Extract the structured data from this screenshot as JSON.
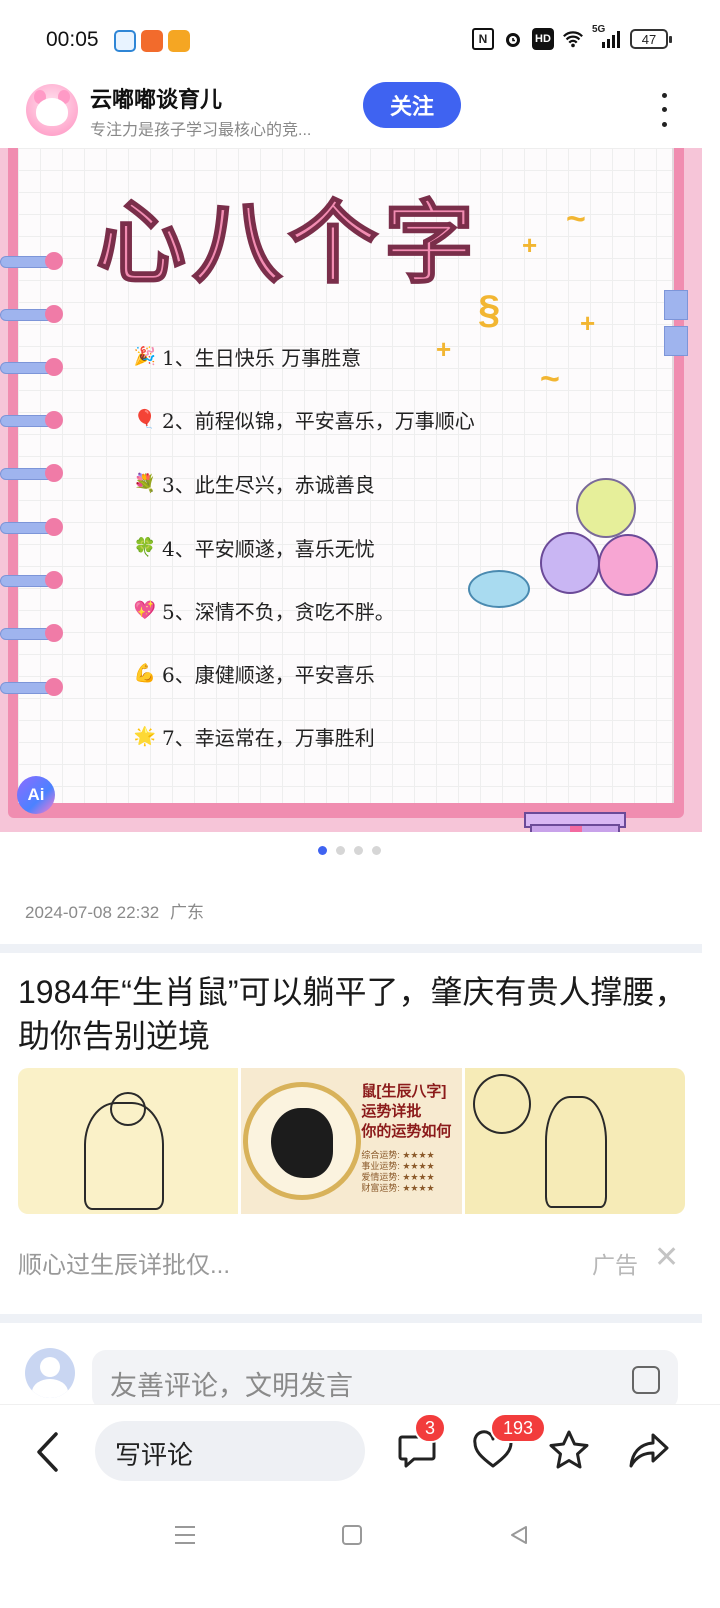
{
  "status_bar": {
    "time": "00:05",
    "battery": "47",
    "network": "5G",
    "hd": "HD",
    "nfc": "N"
  },
  "header": {
    "author_name": "云嘟嘟谈育儿",
    "author_desc": "专注力是孩子学习最核心的竞...",
    "follow_label": "关注"
  },
  "hero": {
    "title": "心八个字",
    "wishes": [
      {
        "icon": "party-popper-icon",
        "glyph": "🎉",
        "text": "1、生日快乐 万事胜意"
      },
      {
        "icon": "balloon-icon",
        "glyph": "🎈",
        "text": "2、前程似锦，平安喜乐，万事顺心"
      },
      {
        "icon": "bouquet-icon",
        "glyph": "💐",
        "text": "3、此生尽兴，赤诚善良"
      },
      {
        "icon": "clover-icon",
        "glyph": "🍀",
        "text": "4、平安顺遂，喜乐无忧"
      },
      {
        "icon": "heart-icon",
        "glyph": "💖",
        "text": "5、深情不负，贪吃不胖。"
      },
      {
        "icon": "flexed-arm-icon",
        "glyph": "💪",
        "text": "6、康健顺遂，平安喜乐"
      },
      {
        "icon": "star-icon",
        "glyph": "🌟",
        "text": "7、幸运常在，万事胜利"
      }
    ],
    "ai_badge": "Ai",
    "page_count": 4,
    "current_page": 1
  },
  "post_meta": {
    "datetime": "2024-07-08 22:32",
    "location": "广东"
  },
  "ad": {
    "title": "1984年“生肖鼠”可以躺平了，肇庆有贵人撑腰，助你告别逆境",
    "image2_title": "鼠[生辰八字]",
    "image2_line1": "运势详批",
    "image2_line2": "你的运势如何",
    "image2_small": "综合运势: ★★★★\n事业运势: ★★★★\n爱情运势: ★★★★\n财富运势: ★★★★",
    "source": "顺心过生辰详批仅...",
    "label": "广告",
    "close": "✕"
  },
  "comment": {
    "placeholder": "友善评论，文明发言"
  },
  "bottom_bar": {
    "write_label": "写评论",
    "comment_count": "3",
    "like_count": "193"
  },
  "colors": {
    "accent": "#3f63f1",
    "badge": "#f23c3c",
    "hero_pink": "#f08db0"
  }
}
